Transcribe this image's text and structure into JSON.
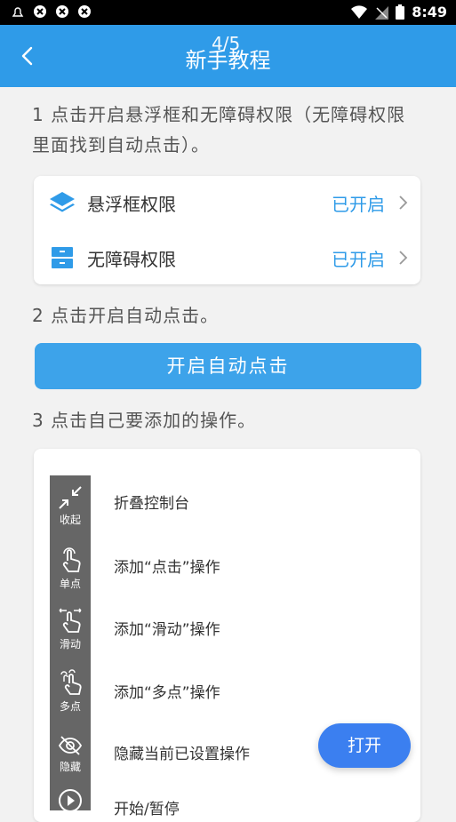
{
  "status_bar": {
    "time": "8:49"
  },
  "header": {
    "title": "新手教程",
    "page_indicator": "4/5"
  },
  "steps": {
    "step1": "1 点击开启悬浮框和无障碍权限（无障碍权限里面找到自动点击）。",
    "step2": "2 点击开启自动点击。",
    "step3": "3 点击自己要添加的操作。"
  },
  "permissions": [
    {
      "label": "悬浮框权限",
      "status": "已开启",
      "icon": "layers-icon"
    },
    {
      "label": "无障碍权限",
      "status": "已开启",
      "icon": "drawer-icon"
    }
  ],
  "start_button": "开启自动点击",
  "controls": [
    {
      "label": "收起",
      "icon": "collapse-icon",
      "description": "折叠控制台"
    },
    {
      "label": "单点",
      "icon": "tap-icon",
      "description": "添加“点击”操作"
    },
    {
      "label": "滑动",
      "icon": "swipe-icon",
      "description": "添加“滑动”操作"
    },
    {
      "label": "多点",
      "icon": "multi-tap-icon",
      "description": "添加“多点”操作"
    },
    {
      "label": "隐藏",
      "icon": "eye-off-icon",
      "description": "隐藏当前已设置操作"
    },
    {
      "label": "",
      "icon": "play-icon",
      "description": "开始/暂停"
    }
  ],
  "open_button": "打开",
  "colors": {
    "accent": "#2f9be8",
    "panel": "#666666",
    "open_button": "#3b7ff0"
  }
}
